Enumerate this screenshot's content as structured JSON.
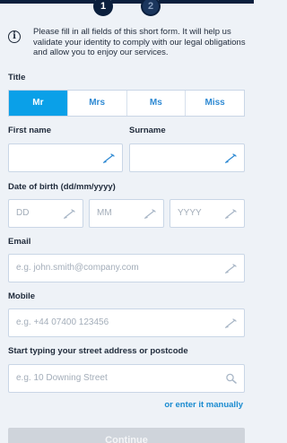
{
  "stepper": {
    "steps": [
      {
        "number": "1"
      },
      {
        "number": "2"
      }
    ]
  },
  "info": {
    "text": "Please fill in all fields of this short form. It will help us validate your identity to comply with our legal obligations and allow you to enjoy our services."
  },
  "title": {
    "label": "Title",
    "options": [
      "Mr",
      "Mrs",
      "Ms",
      "Miss"
    ],
    "selected": "Mr"
  },
  "first_name": {
    "label": "First name",
    "value": ""
  },
  "surname": {
    "label": "Surname",
    "value": ""
  },
  "dob": {
    "label": "Date of birth (dd/mm/yyyy)",
    "day_placeholder": "DD",
    "month_placeholder": "MM",
    "year_placeholder": "YYYY"
  },
  "email": {
    "label": "Email",
    "placeholder": "e.g. john.smith@company.com"
  },
  "mobile": {
    "label": "Mobile",
    "placeholder": "e.g. +44 07400 123456"
  },
  "address": {
    "label": "Start typing your street address or postcode",
    "placeholder": "e.g. 10 Downing Street"
  },
  "manual_link": "or enter it manually",
  "continue_label": "Continue",
  "icons": {
    "info": "info-icon",
    "pencil": "pencil-icon",
    "search": "search-icon"
  }
}
